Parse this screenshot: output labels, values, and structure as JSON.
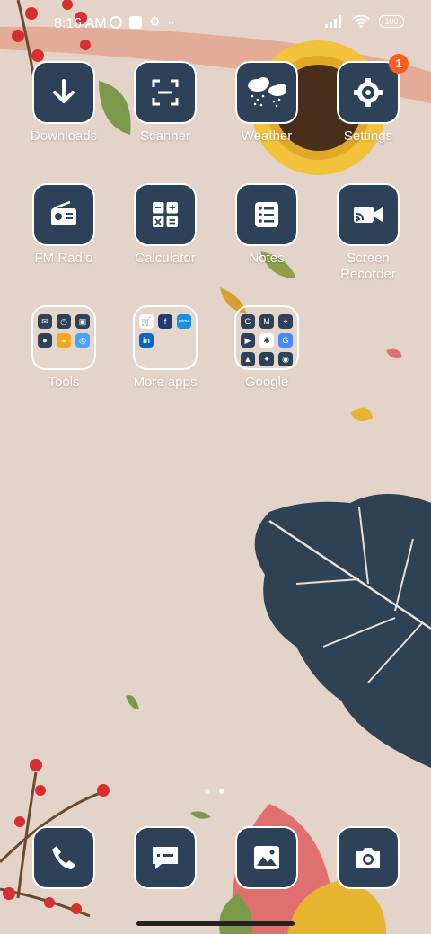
{
  "status_bar": {
    "time": "8:16 AM",
    "battery": "100"
  },
  "apps": [
    {
      "label": "Downloads",
      "icon": "download-arrow-icon"
    },
    {
      "label": "Scanner",
      "icon": "scan-frame-icon"
    },
    {
      "label": "Weather",
      "icon": "cloud-rain-icon"
    },
    {
      "label": "Settings",
      "icon": "gear-icon",
      "badge": "1"
    },
    {
      "label": "FM Radio",
      "icon": "radio-icon"
    },
    {
      "label": "Calculator",
      "icon": "calculator-icon"
    },
    {
      "label": "Notes",
      "icon": "notes-list-icon"
    },
    {
      "label": "Screen\nRecorder",
      "icon": "screen-recorder-icon"
    }
  ],
  "folders": [
    {
      "label": "Tools"
    },
    {
      "label": "More apps"
    },
    {
      "label": "Google"
    }
  ],
  "dock": [
    {
      "icon": "phone-icon"
    },
    {
      "icon": "messages-icon"
    },
    {
      "icon": "gallery-icon"
    },
    {
      "icon": "camera-icon"
    }
  ],
  "colors": {
    "wallpaper": "#e3d3c8",
    "icon_bg": "#2d4258",
    "badge": "#ff5a1f"
  }
}
